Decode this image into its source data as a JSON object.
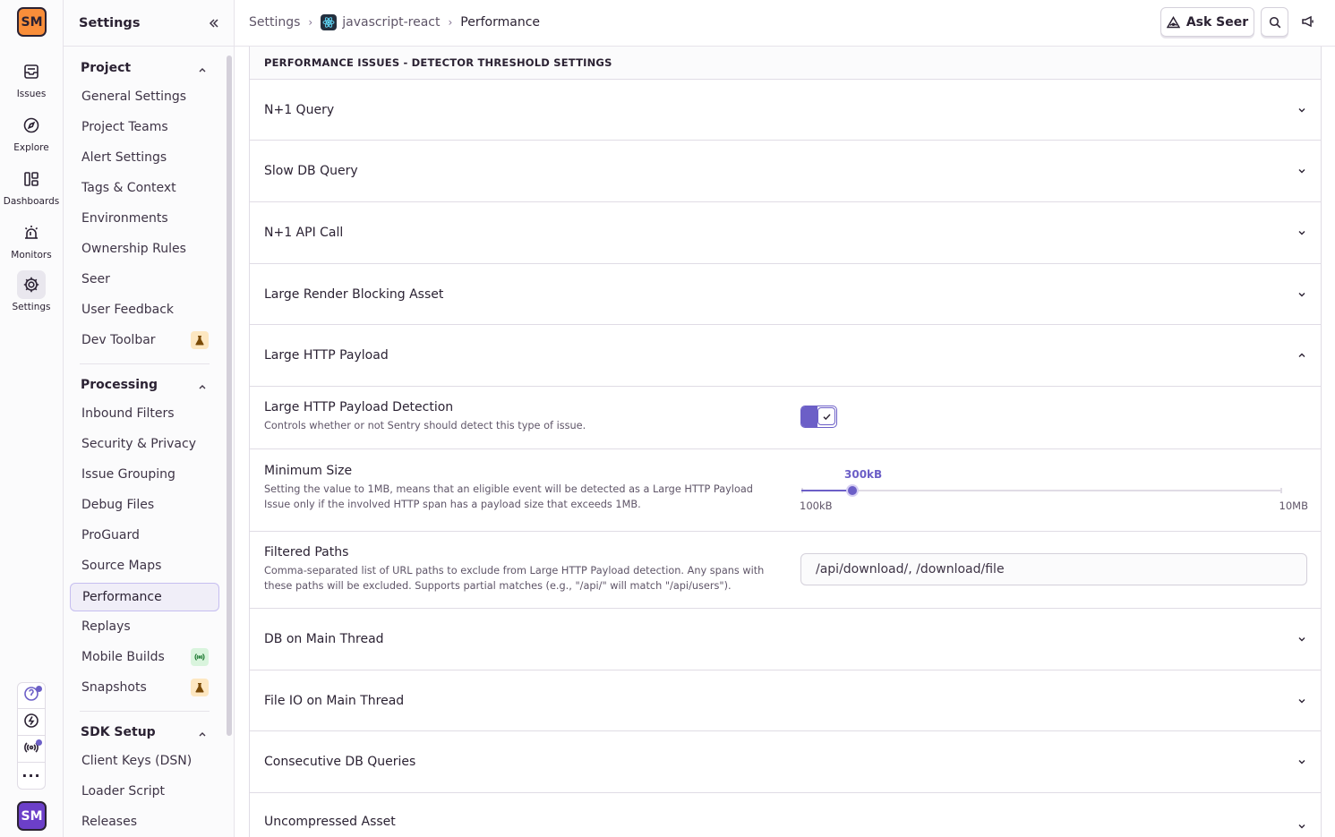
{
  "org": {
    "initials": "SM"
  },
  "rail": {
    "items": [
      {
        "label": "Issues",
        "icon": "issues-icon"
      },
      {
        "label": "Explore",
        "icon": "compass-icon"
      },
      {
        "label": "Dashboards",
        "icon": "dashboard-icon"
      },
      {
        "label": "Monitors",
        "icon": "siren-icon"
      },
      {
        "label": "Settings",
        "icon": "gear-icon",
        "active": true
      }
    ],
    "user_initials": "SM"
  },
  "secnav": {
    "title": "Settings",
    "groups": [
      {
        "title": "Project",
        "items": [
          "General Settings",
          "Project Teams",
          "Alert Settings",
          "Tags & Context",
          "Environments",
          "Ownership Rules",
          "Seer",
          "User Feedback",
          "Dev Toolbar"
        ]
      },
      {
        "title": "Processing",
        "items": [
          "Inbound Filters",
          "Security & Privacy",
          "Issue Grouping",
          "Debug Files",
          "ProGuard",
          "Source Maps",
          "Performance",
          "Replays",
          "Mobile Builds",
          "Snapshots"
        ]
      },
      {
        "title": "SDK Setup",
        "items": [
          "Client Keys (DSN)",
          "Loader Script",
          "Releases"
        ]
      }
    ],
    "active_item": "Performance"
  },
  "breadcrumb": {
    "root": "Settings",
    "project": "javascript-react",
    "current": "Performance"
  },
  "topbar": {
    "ask_seer": "Ask Seer"
  },
  "panel": {
    "header": "PERFORMANCE ISSUES - DETECTOR THRESHOLD SETTINGS",
    "rows_before": [
      "N+1 Query",
      "Slow DB Query",
      "N+1 API Call",
      "Large Render Blocking Asset"
    ],
    "expanded": {
      "title": "Large HTTP Payload",
      "detection_label": "Large HTTP Payload Detection",
      "detection_help": "Controls whether or not Sentry should detect this type of issue.",
      "detection_enabled": true,
      "min_size_label": "Minimum Size",
      "min_size_help": "Setting the value to 1MB, means that an eligible event will be detected as a Large HTTP Payload Issue only if the involved HTTP span has a payload size that exceeds 1MB.",
      "min_size_value": "300kB",
      "min_size_min": "100kB",
      "min_size_max": "10MB",
      "min_size_fraction": 0.107,
      "paths_label": "Filtered Paths",
      "paths_help": "Comma-separated list of URL paths to exclude from Large HTTP Payload detection. Any spans with these paths will be excluded. Supports partial matches (e.g., \"/api/\" will match \"/api/users\").",
      "paths_value": "/api/download/, /download/file"
    },
    "rows_after": [
      "DB on Main Thread",
      "File IO on Main Thread",
      "Consecutive DB Queries",
      "Uncompressed Asset"
    ]
  },
  "colors": {
    "accent": "#6c5fc7",
    "org_badge": "#f98e3a",
    "avatar": "#6c3fc9"
  }
}
